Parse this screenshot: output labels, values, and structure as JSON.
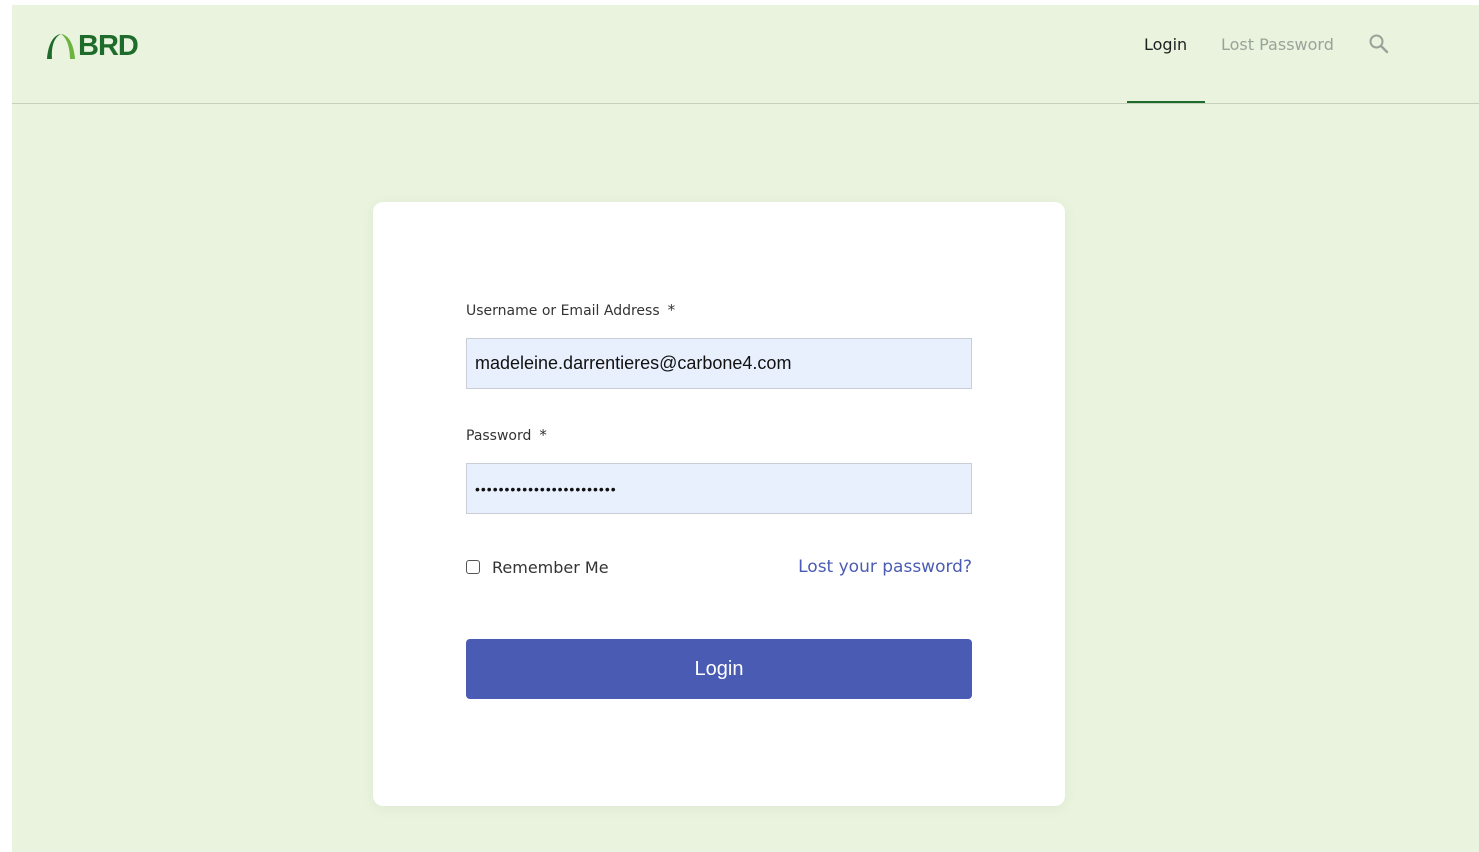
{
  "header": {
    "logo_text": "BRD",
    "nav": {
      "login_label": "Login",
      "lost_password_label": "Lost Password"
    },
    "search_icon": "search-icon"
  },
  "form": {
    "username_label": "Username or Email Address",
    "username_value": "madeleine.darrentieres@carbone4.com",
    "password_label": "Password",
    "password_value": "••••••••••••••••••••••••",
    "required_marker": "*",
    "remember_label": "Remember Me",
    "lost_link": "Lost your password?",
    "submit_label": "Login"
  },
  "colors": {
    "page_bg": "#e9f3dd",
    "brand_green": "#1f6b2c",
    "logo_light_green": "#6cb33f",
    "button_blue": "#4a5bb4",
    "link_blue": "#4a5cb3",
    "input_bg": "#e8f0fe"
  }
}
